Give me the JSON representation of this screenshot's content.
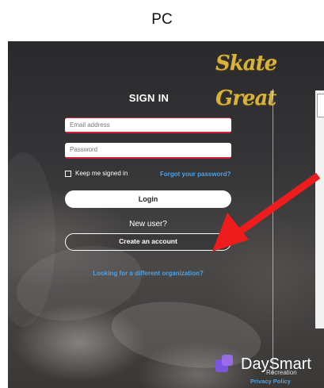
{
  "caption": "PC",
  "brand": {
    "logo_text": "Skate Great"
  },
  "sign_in": {
    "title": "SIGN IN",
    "email_placeholder": "Email address",
    "password_placeholder": "Password",
    "keep_signed_in": "Keep me signed in",
    "forgot_password": "Forgot your password?",
    "login_button": "Login",
    "new_user_text": "New user?",
    "create_account_button": "Create an account",
    "different_org_link": "Looking for a different organization?"
  },
  "footer": {
    "daysmart_text": "DaySmart",
    "daysmart_sub": "Recreation",
    "privacy_policy": "Privacy Policy"
  },
  "annotation": {
    "arrow_color": "#ee1c1c"
  },
  "colors": {
    "accent_red": "#d21f3c",
    "link_blue": "#4aa3e8",
    "logo_gold": "#d8b33a"
  }
}
